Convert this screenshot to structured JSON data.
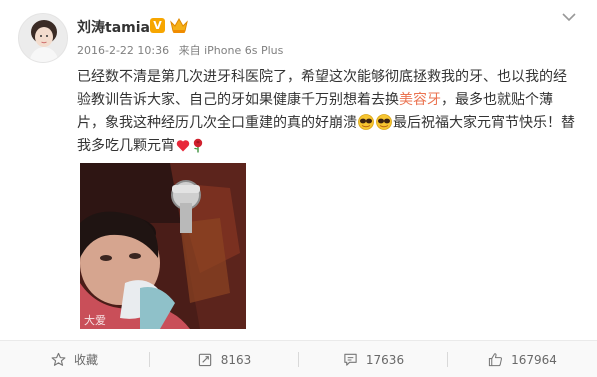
{
  "post": {
    "username": "刘涛tamia",
    "verified_badge": "V",
    "timestamp": "2016-2-22 10:36",
    "source": "来自 iPhone 6s Plus",
    "line1": "已经数不清是第几次进牙科医院了，希望这次能够彻底拯救我的牙、也以我的经",
    "line2_a": "验教训告诉大家、自己的牙如果健康千万别想着去换",
    "line2_hl": "美容牙",
    "line2_b": "，最多也就贴个薄",
    "line3_a": "片，象我这种经历几次全口重建的真的好崩溃",
    "line3_b": "最后祝福大家元宵节快乐！替",
    "line4": "我多吃几颗元宵",
    "photo_watermark": "大爱"
  },
  "actions": {
    "favorite_label": "收藏",
    "repost_count": "8163",
    "comment_count": "17636",
    "like_count": "167964"
  },
  "colors": {
    "highlight": "#eb7350",
    "vip_badge": "#f7a600",
    "text": "#333333",
    "meta": "#808080"
  }
}
